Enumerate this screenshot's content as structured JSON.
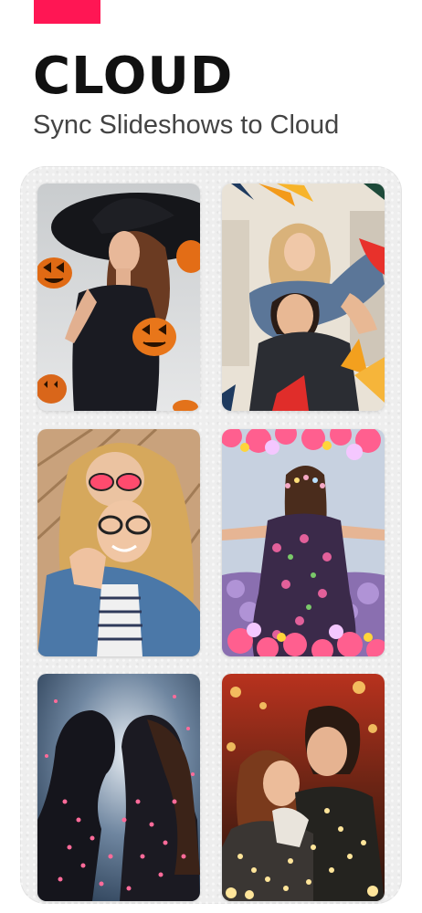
{
  "header": {
    "title": "CLOUD",
    "subtitle": "Sync Slideshows to Cloud"
  },
  "colors": {
    "accent": "#ff1654",
    "title": "#111111",
    "subtitle": "#444444"
  },
  "gallery": {
    "thumbnails": [
      {
        "subject": "woman-with-hat-and-pumpkins-photo"
      },
      {
        "subject": "couple-piggyback-with-leaves-photo"
      },
      {
        "subject": "woman-with-glasses-collage-photo"
      },
      {
        "subject": "woman-with-flowers-back-view-photo"
      },
      {
        "subject": "couple-silhouette-with-hearts-photo"
      },
      {
        "subject": "couple-with-fairy-lights-photo"
      }
    ]
  }
}
